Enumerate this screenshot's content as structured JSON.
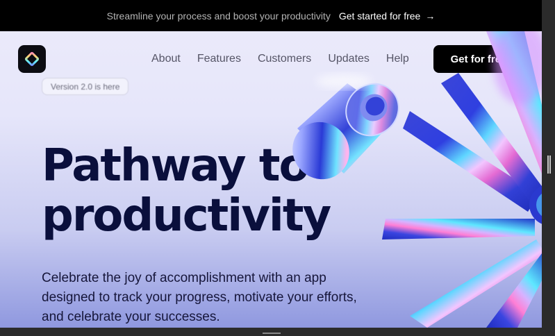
{
  "announcement": {
    "message": "Streamline your process and boost your productivity",
    "cta_label": "Get started for free",
    "cta_arrow": "→"
  },
  "header": {
    "logo_icon": "diamond-logo-icon",
    "nav": [
      "About",
      "Features",
      "Customers",
      "Updates",
      "Help"
    ],
    "cta_label": "Get for free"
  },
  "hero": {
    "version_pill": "Version 2.0 is here",
    "headline_line1": "Pathway to",
    "headline_line2": "productivity",
    "subtitle": "Celebrate the joy of accomplishment with an app designed to track your progress, motivate your efforts, and celebrate your successes."
  },
  "colors": {
    "announcement_bg": "#000000",
    "headline": "#0a0f3c",
    "cta_bg": "#000000",
    "hero_gradient_top": "#ecebfb",
    "hero_gradient_bottom": "#8f98df"
  }
}
